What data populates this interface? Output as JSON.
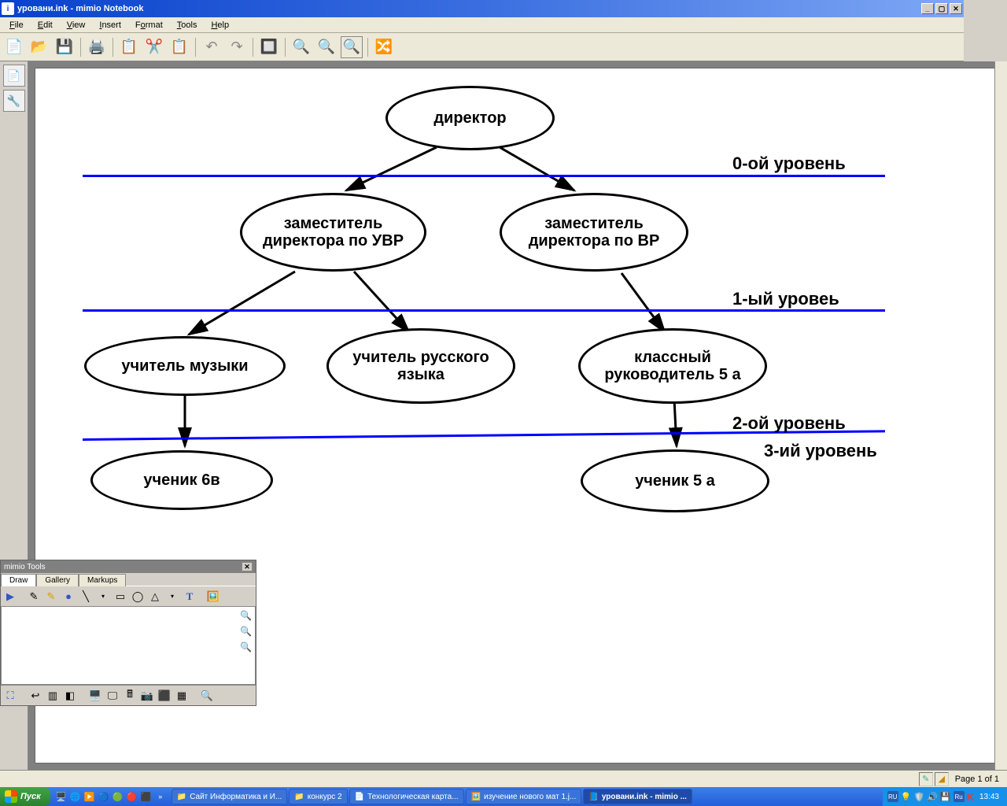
{
  "window": {
    "title": "уровани.ink - mimio Notebook",
    "icon_letter": "i"
  },
  "menu": {
    "file": "File",
    "edit": "Edit",
    "view": "View",
    "insert": "Insert",
    "format": "Format",
    "tools": "Tools",
    "help": "Help"
  },
  "diagram": {
    "nodes": {
      "director": "директор",
      "deputy_uvr": "заместитель директора по УВР",
      "deputy_vr": "заместитель директора по ВР",
      "music_teacher": "учитель музыки",
      "rus_teacher": "учитель русского языка",
      "class_head": "классный руководитель 5 а",
      "student_6v": "ученик 6в",
      "student_5a": "ученик 5 а"
    },
    "levels": {
      "l0": "0-ой уровень",
      "l1": "1-ый уровеь",
      "l2": "2-ой уровень",
      "l3": "3-ий уровень"
    }
  },
  "mimio_tools": {
    "title": "mimio Tools",
    "tabs": {
      "draw": "Draw",
      "gallery": "Gallery",
      "markups": "Markups"
    }
  },
  "status": {
    "page": "Page 1 of 1",
    "lang": "RU"
  },
  "taskbar": {
    "start": "Пуск",
    "items": {
      "site": "Сайт Информатика и И...",
      "konkurs": "конкурс 2",
      "tech": "Технологическая карта...",
      "study": "изучение нового мат 1.j...",
      "mimio": "уровани.ink - mimio ..."
    },
    "tray_lang": "RU",
    "tray_lang2": "Ru",
    "clock": "13:43"
  }
}
